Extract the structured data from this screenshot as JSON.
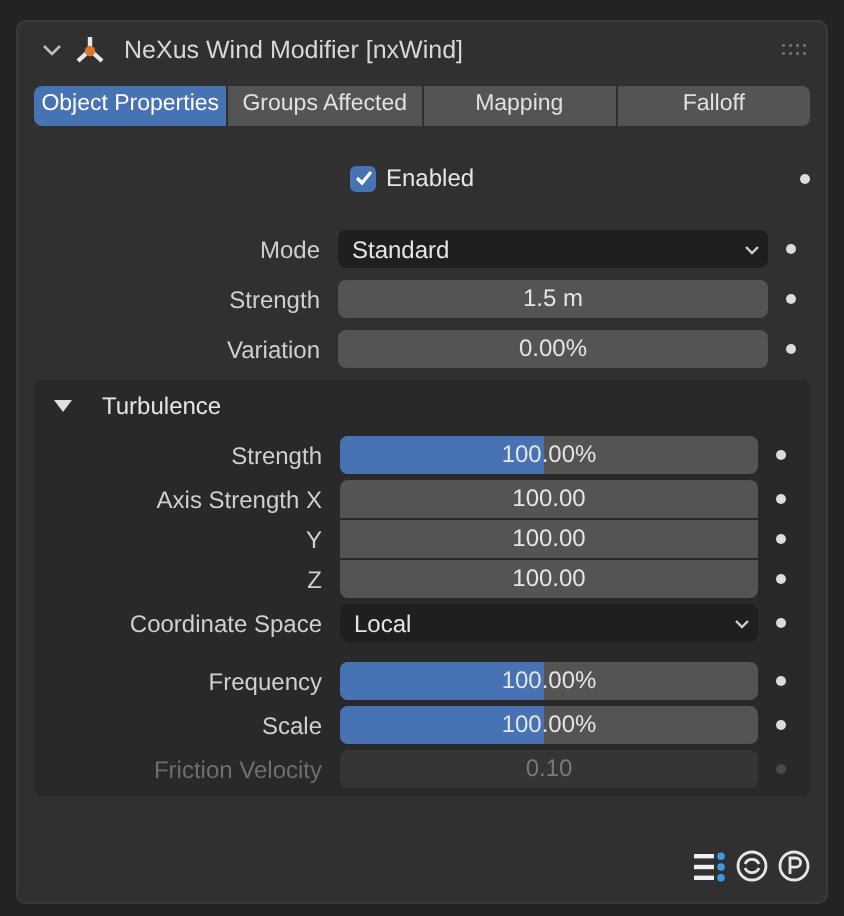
{
  "panel": {
    "title": "NeXus Wind Modifier [nxWind]",
    "expanded": true
  },
  "tabs": [
    {
      "label": "Object Properties",
      "selected": true
    },
    {
      "label": "Groups Affected",
      "selected": false
    },
    {
      "label": "Mapping",
      "selected": false
    },
    {
      "label": "Falloff",
      "selected": false
    }
  ],
  "enabled": {
    "label": "Enabled",
    "checked": true
  },
  "properties": [
    {
      "kind": "enum",
      "label": "Mode",
      "value": "Standard"
    },
    {
      "kind": "number",
      "label": "Strength",
      "value": "1.5 m"
    },
    {
      "kind": "number",
      "label": "Variation",
      "value": "0.00%"
    }
  ],
  "turbulence": {
    "title": "Turbulence",
    "expanded": true,
    "sections": [
      [
        {
          "kind": "slider",
          "label": "Strength",
          "value": "100.00%",
          "level": 0.49,
          "disabled": false
        },
        {
          "kind": "vector",
          "labels": [
            "Axis Strength X",
            "Y",
            "Z"
          ],
          "values": [
            "100.00",
            "100.00",
            "100.00"
          ],
          "disabled": false
        },
        {
          "kind": "enum",
          "label": "Coordinate Space",
          "value": "Local",
          "disabled": false
        }
      ],
      [
        {
          "kind": "slider",
          "label": "Frequency",
          "value": "100.00%",
          "level": 0.49,
          "disabled": false
        },
        {
          "kind": "slider",
          "label": "Scale",
          "value": "100.00%",
          "level": 0.49,
          "disabled": false
        },
        {
          "kind": "number",
          "label": "Friction Velocity",
          "value": "0.10",
          "disabled": true
        }
      ]
    ]
  }
}
